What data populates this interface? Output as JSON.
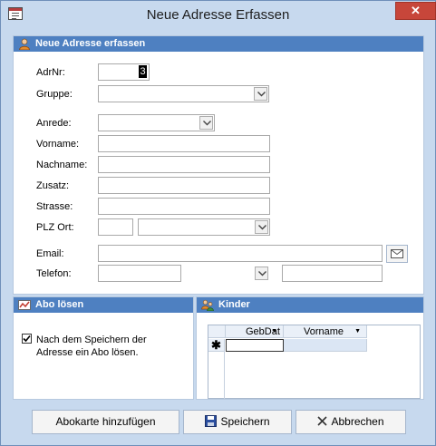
{
  "window": {
    "title": "Neue Adresse Erfassen",
    "close_glyph": "✕"
  },
  "address_section": {
    "header": "Neue Adresse erfassen",
    "labels": {
      "adrnr": "AdrNr:",
      "gruppe": "Gruppe:",
      "anrede": "Anrede:",
      "vorname": "Vorname:",
      "nachname": "Nachname:",
      "zusatz": "Zusatz:",
      "strasse": "Strasse:",
      "plz_ort": "PLZ Ort:",
      "email": "Email:",
      "telefon": "Telefon:"
    },
    "values": {
      "adrnr": "3"
    }
  },
  "abo_section": {
    "header": "Abo lösen",
    "checkbox_checked": true,
    "checkbox_label_line1": "Nach dem Speichern der",
    "checkbox_label_line2": "Adresse ein Abo lösen."
  },
  "kinder_section": {
    "header": "Kinder",
    "columns": [
      "GebDat",
      "Vorname"
    ],
    "new_row_marker": "✱"
  },
  "buttons": {
    "abokarte": "Abokarte hinzufügen",
    "speichern": "Speichern",
    "abbrechen": "Abbrechen"
  },
  "icons": {
    "app": "form-icon",
    "address_header": "person-icon",
    "abo_header": "chart-icon",
    "kinder_header": "people-icon",
    "email_button": "envelope-icon",
    "save": "floppy-disk-icon",
    "cancel": "x-icon"
  }
}
